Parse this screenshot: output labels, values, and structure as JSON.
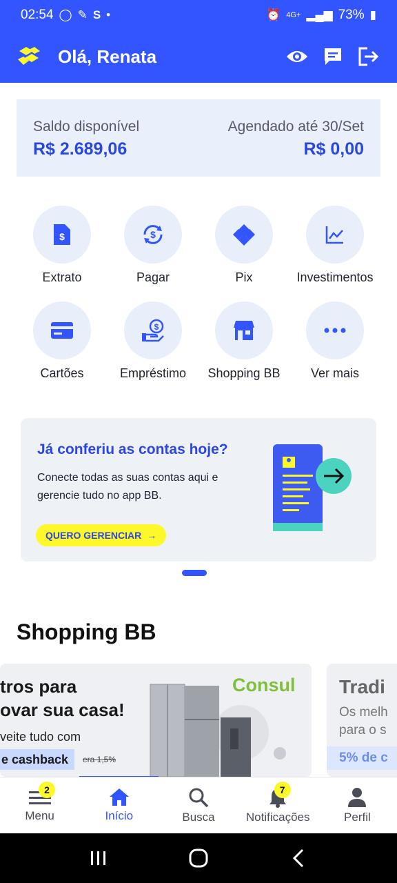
{
  "status_bar": {
    "time": "02:54",
    "network": "4G+",
    "battery": "73%"
  },
  "header": {
    "greeting": "Olá, Renata"
  },
  "balance": {
    "available_label": "Saldo disponível",
    "available_value": "R$ 2.689,06",
    "scheduled_label": "Agendado até 30/Set",
    "scheduled_value": "R$ 0,00"
  },
  "shortcuts": [
    {
      "label": "Extrato",
      "icon": "statement-icon"
    },
    {
      "label": "Pagar",
      "icon": "pay-icon"
    },
    {
      "label": "Pix",
      "icon": "pix-icon"
    },
    {
      "label": "Investimentos",
      "icon": "chart-icon"
    },
    {
      "label": "Cartões",
      "icon": "card-icon"
    },
    {
      "label": "Empréstimo",
      "icon": "loan-icon"
    },
    {
      "label": "Shopping BB",
      "icon": "store-icon"
    },
    {
      "label": "Ver mais",
      "icon": "more-icon"
    }
  ],
  "promo": {
    "title": "Já conferiu as contas hoje?",
    "text": "Conecte todas as suas contas aqui e gerencie tudo no app BB.",
    "button": "QUERO GERENCIAR"
  },
  "shopping": {
    "title": "Shopping BB",
    "card1": {
      "line1": "tros para",
      "line2": "ovar sua casa!",
      "line3": "veite tudo com",
      "cashback": "e cashback",
      "old": "era 1,5%",
      "brand": "Consul"
    },
    "card2": {
      "title": "Tradi",
      "sub1": "Os melh",
      "sub2": "para o s",
      "badge": "5% de c"
    }
  },
  "bottom_nav": [
    {
      "label": "Menu",
      "badge": "2"
    },
    {
      "label": "Início",
      "badge": ""
    },
    {
      "label": "Busca",
      "badge": ""
    },
    {
      "label": "Notificações",
      "badge": "7"
    },
    {
      "label": "Perfil",
      "badge": ""
    }
  ],
  "colors": {
    "primary": "#3355ff",
    "accent_yellow": "#fcf82a",
    "light_blue": "#e9f0fb"
  }
}
